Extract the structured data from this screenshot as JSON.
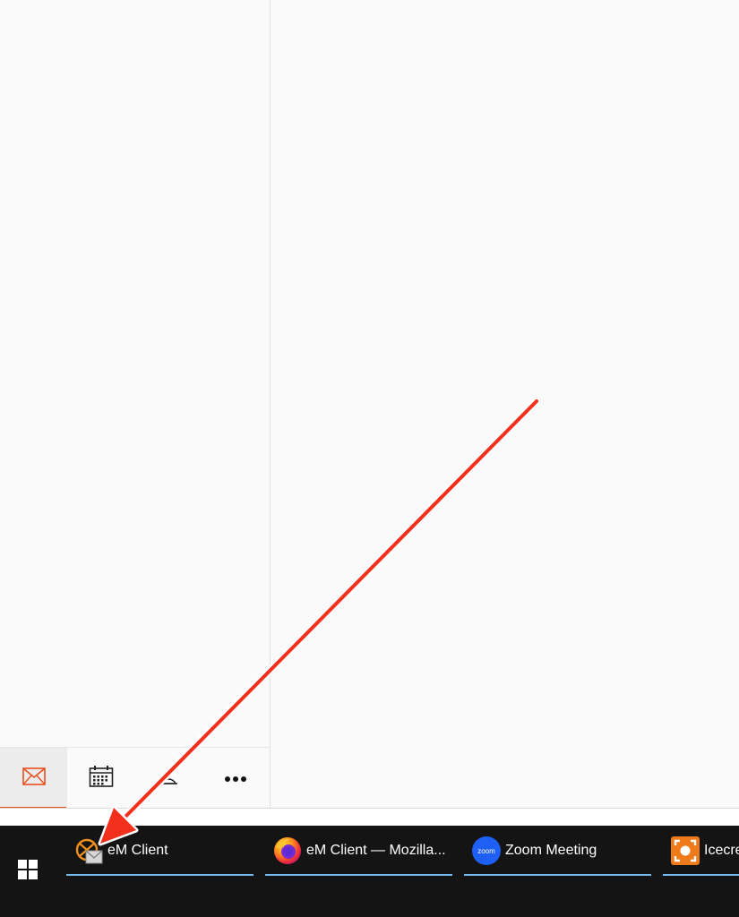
{
  "taskbar": {
    "items": [
      {
        "label": "eM Client",
        "icon": "em-client-icon"
      },
      {
        "label": "eM Client — Mozilla...",
        "icon": "firefox-icon"
      },
      {
        "label": "Zoom Meeting",
        "icon": "zoom-icon",
        "icon_text": "zoom"
      },
      {
        "label": "Icecre",
        "icon": "icecream-recorder-icon"
      }
    ]
  },
  "nav": {
    "items": [
      {
        "icon": "mail-icon",
        "active": true
      },
      {
        "icon": "calendar-icon",
        "active": false
      },
      {
        "icon": "contacts-icon",
        "active": false
      },
      {
        "icon": "more-icon",
        "active": false
      }
    ]
  },
  "colors": {
    "accent": "#e8501e",
    "taskbar_bg": "#141414",
    "taskbar_underline": "#76b9ed",
    "annotation_arrow": "#f2301b"
  }
}
